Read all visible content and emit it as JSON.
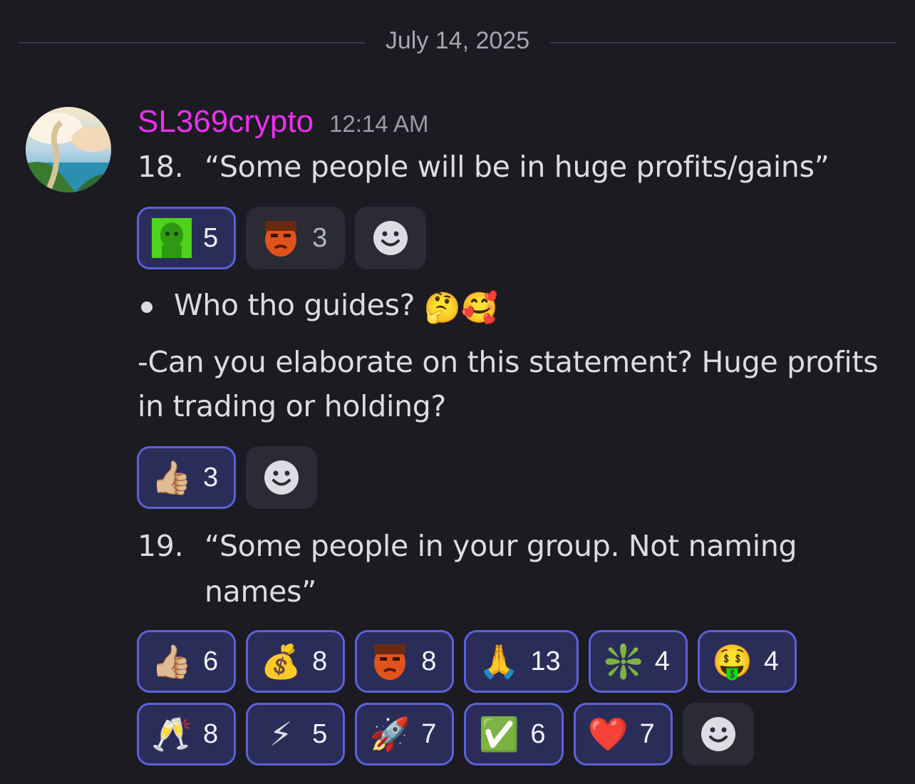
{
  "date_divider": "July 14, 2025",
  "message": {
    "username": "SL369crypto",
    "time": "12:14 AM",
    "lines": {
      "item18_num": "18.",
      "item18_text": "“Some people will be in huge profits/gains”",
      "bullet_text": "Who tho guides?",
      "bullet_emojis": "🤔🥰",
      "para1": "-Can you elaborate on this statement? Huge profits",
      "para2": "in trading or holding?",
      "item19_num": "19.",
      "item19_text1": "“Some people in your group. Not naming",
      "item19_text2": "names”"
    }
  },
  "reactions_1": [
    {
      "icon": "pepe-sticker-icon",
      "count": "5",
      "me": true
    },
    {
      "icon": "leo-face-sticker-icon",
      "count": "3",
      "me": false
    }
  ],
  "reactions_2": [
    {
      "icon": "thumbs-up-icon",
      "emoji": "👍🏼",
      "count": "3",
      "me": true
    }
  ],
  "reactions_3": [
    {
      "icon": "thumbs-up-icon",
      "emoji": "👍🏼",
      "count": "6"
    },
    {
      "icon": "money-bag-icon",
      "emoji": "💰",
      "count": "8"
    },
    {
      "icon": "leo-face-sticker-icon",
      "count": "8"
    },
    {
      "icon": "praying-hands-icon",
      "emoji": "🙏",
      "count": "13"
    },
    {
      "icon": "sparkle-icon",
      "emoji": "❇️",
      "count": "4"
    },
    {
      "icon": "money-mouth-icon",
      "emoji": "🤑",
      "count": "4"
    }
  ],
  "reactions_4": [
    {
      "icon": "champagne-icon",
      "emoji": "🥂",
      "count": "8"
    },
    {
      "icon": "lightning-icon",
      "emoji": "⚡",
      "count": "5"
    },
    {
      "icon": "rocket-icon",
      "emoji": "🚀",
      "count": "7"
    },
    {
      "icon": "check-mark-icon",
      "emoji": "✅",
      "count": "6"
    },
    {
      "icon": "heart-icon",
      "emoji": "❤️",
      "count": "7"
    }
  ],
  "colors": {
    "background": "#1b1b21",
    "username": "#ee2ff0",
    "reacted_border": "#5a62d8",
    "reacted_bg": "#2b2d59"
  }
}
